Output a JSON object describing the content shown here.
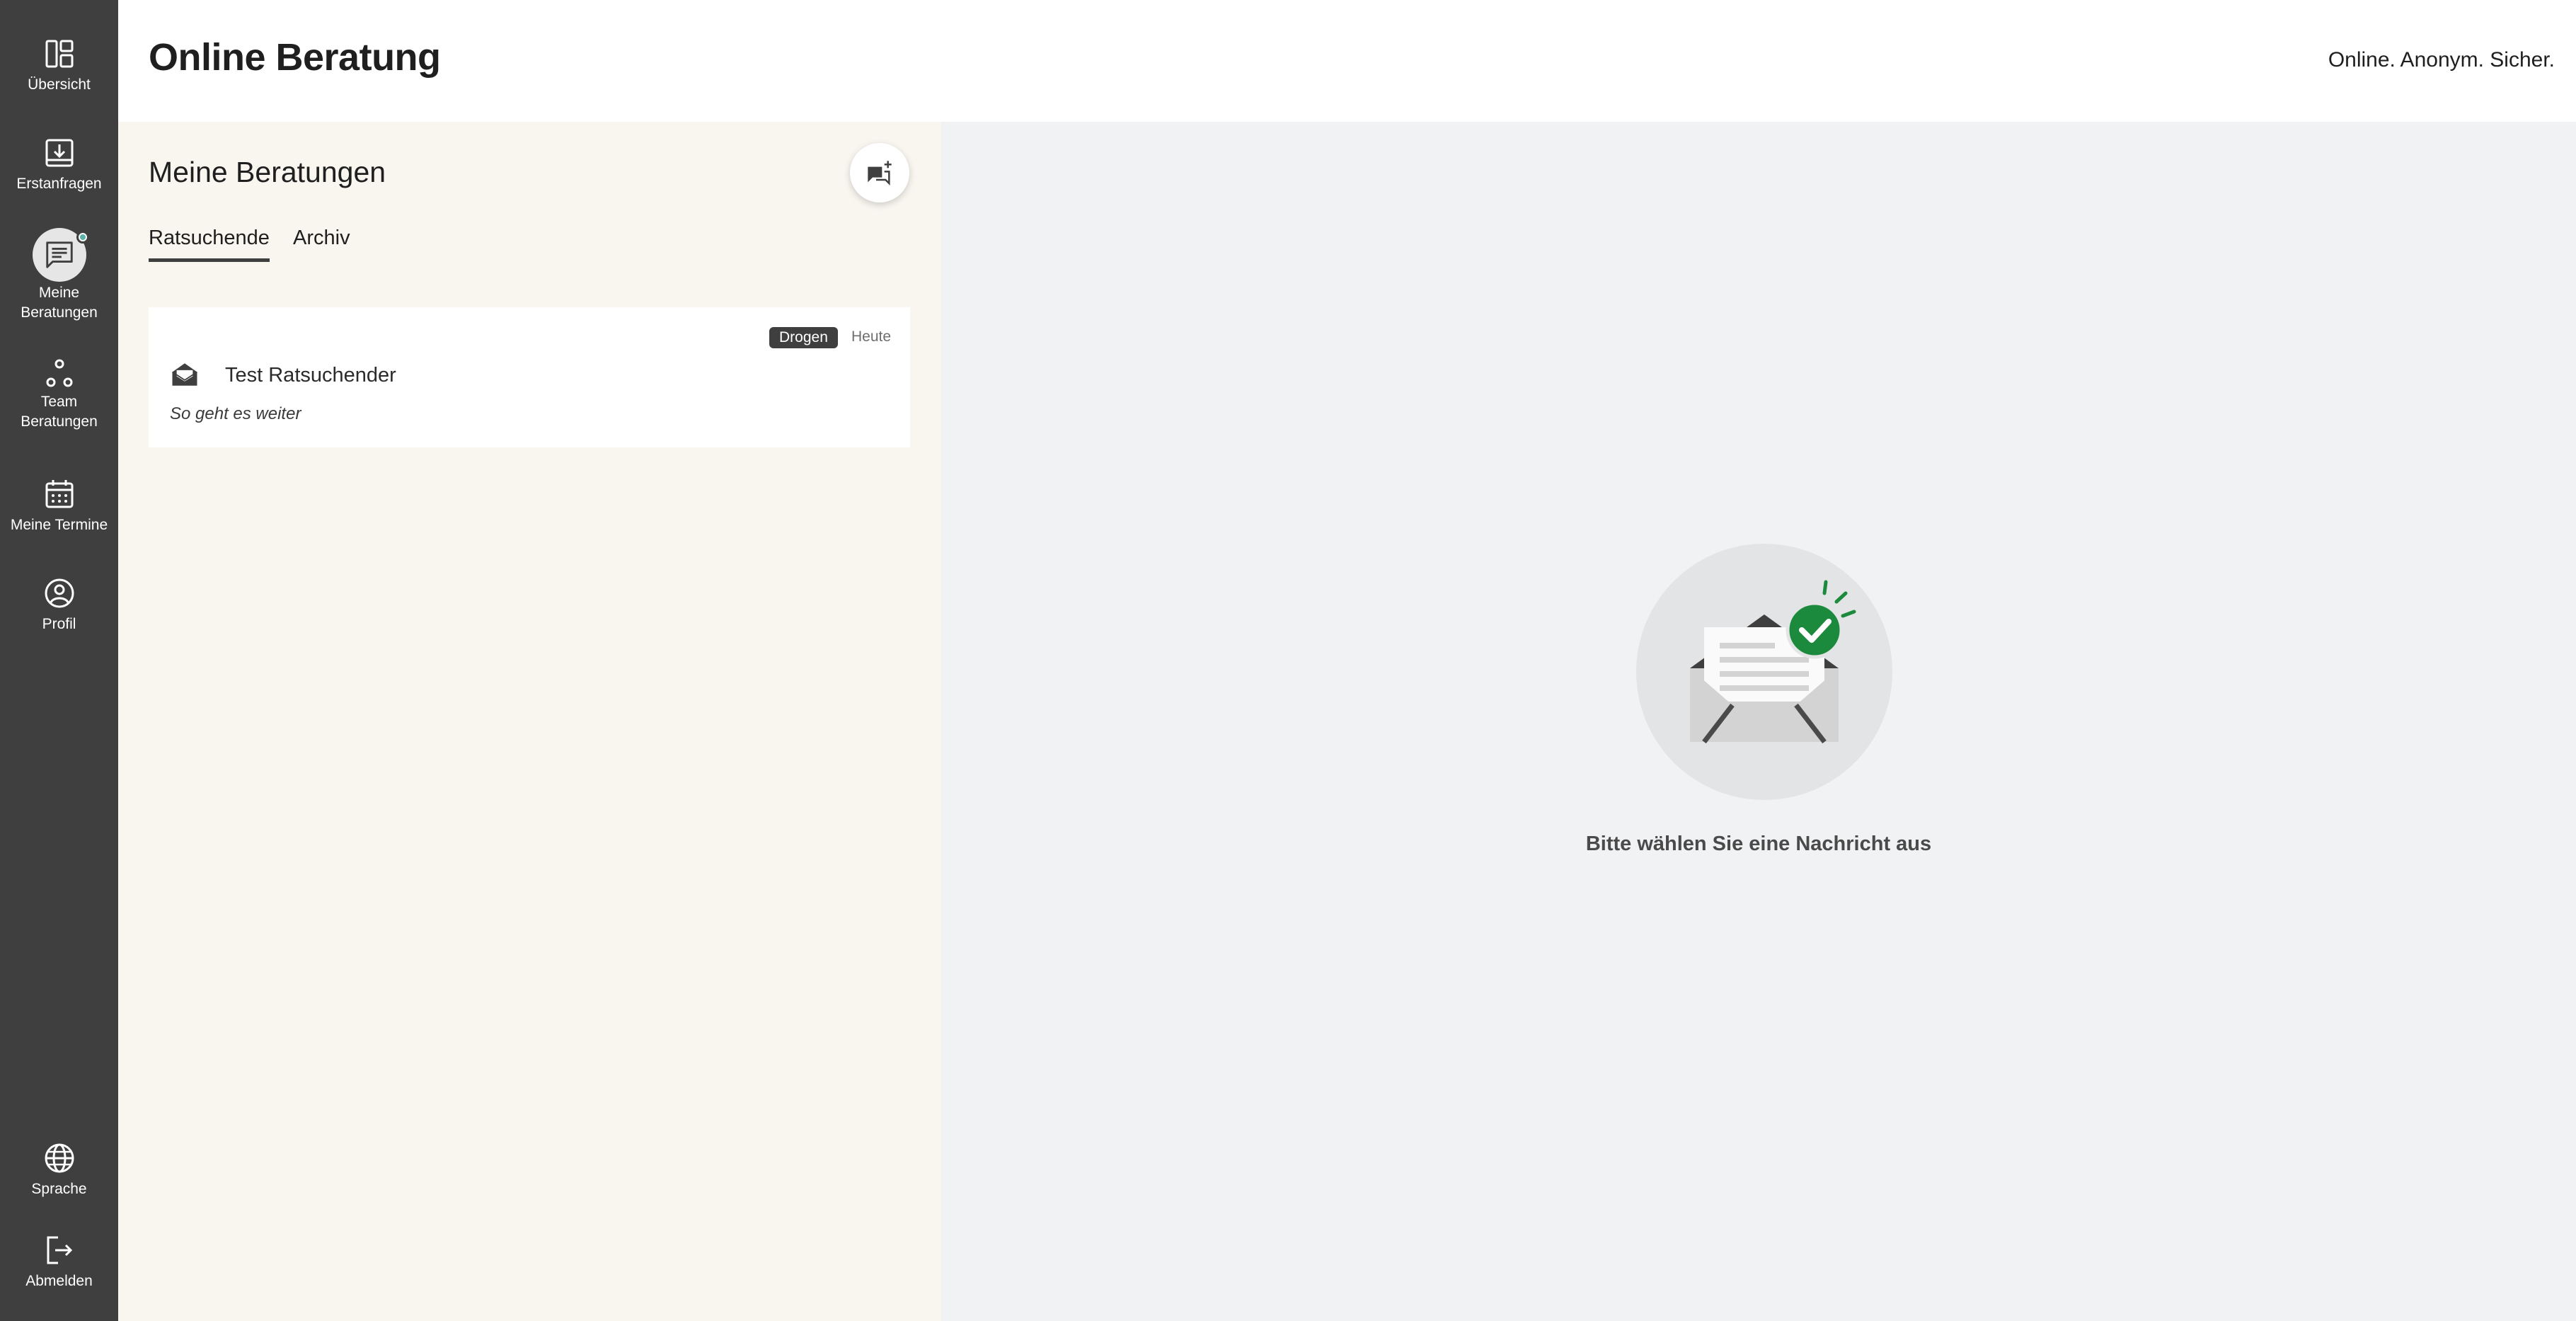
{
  "sidebar": {
    "items": [
      {
        "label": "Übersicht",
        "icon": "overview-icon"
      },
      {
        "label": "Erstanfragen",
        "icon": "inbox-download-icon"
      },
      {
        "label_line1": "Meine",
        "label_line2": "Beratungen",
        "icon": "chat-bubble-icon",
        "active": true,
        "has_notification": true
      },
      {
        "label_line1": "Team",
        "label_line2": "Beratungen",
        "icon": "team-icon"
      },
      {
        "label": "Meine Termine",
        "icon": "calendar-icon"
      },
      {
        "label": "Profil",
        "icon": "profile-icon"
      }
    ],
    "bottom_items": [
      {
        "label": "Sprache",
        "icon": "globe-icon"
      },
      {
        "label": "Abmelden",
        "icon": "logout-icon"
      }
    ]
  },
  "header": {
    "title": "Online Beratung",
    "claim": "Online. Anonym. Sicher."
  },
  "list_panel": {
    "title": "Meine Beratungen",
    "compose_icon": "new-chat-icon",
    "tabs": [
      {
        "label": "Ratsuchende",
        "active": true
      },
      {
        "label": "Archiv",
        "active": false
      }
    ],
    "sessions": [
      {
        "topic": "Drogen",
        "date": "Heute",
        "name": "Test Ratsuchender",
        "preview": "So geht es weiter",
        "icon": "envelope-open-icon"
      }
    ]
  },
  "detail_panel": {
    "empty_illustration": "envelope-check-illustration",
    "empty_text": "Bitte wählen Sie eine Nachricht aus"
  },
  "colors": {
    "sidebar_bg": "#3f3f3f",
    "list_bg": "#f9f6f0",
    "detail_bg": "#f1f2f4",
    "success_green": "#1b8a3c",
    "notification_dot": "#5ab3a8"
  }
}
